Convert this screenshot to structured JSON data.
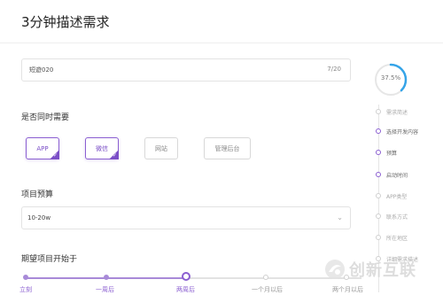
{
  "page": {
    "title": "3分钟描述需求"
  },
  "project_name": {
    "value": "短遊020",
    "counter": "7/20"
  },
  "platforms": {
    "label": "是否同时需要",
    "options": [
      {
        "label": "APP",
        "selected": true
      },
      {
        "label": "微信",
        "selected": true
      },
      {
        "label": "网站",
        "selected": false
      },
      {
        "label": "管理后台",
        "selected": false
      }
    ]
  },
  "budget": {
    "label": "项目预算",
    "value": "10-20w"
  },
  "start": {
    "label": "期望项目开始于",
    "marks": [
      "立刻",
      "一周后",
      "两周后",
      "一个月以后",
      "两个月以后"
    ],
    "selected_index": 2
  },
  "progress": {
    "percent_text": "37.5%",
    "fraction": 0.375,
    "steps": [
      {
        "label": "需求简述",
        "done": false
      },
      {
        "label": "选择开发内容",
        "done": true
      },
      {
        "label": "预算",
        "done": true
      },
      {
        "label": "启动时间",
        "done": true
      },
      {
        "label": "APP类型",
        "done": false
      },
      {
        "label": "联系方式",
        "done": false
      },
      {
        "label": "所在地区",
        "done": false
      },
      {
        "label": "详细需求描述",
        "done": false
      }
    ]
  },
  "watermark": {
    "text": "创新互联"
  },
  "colors": {
    "accent": "#7b4fc7",
    "ring": "#35a4e8"
  }
}
